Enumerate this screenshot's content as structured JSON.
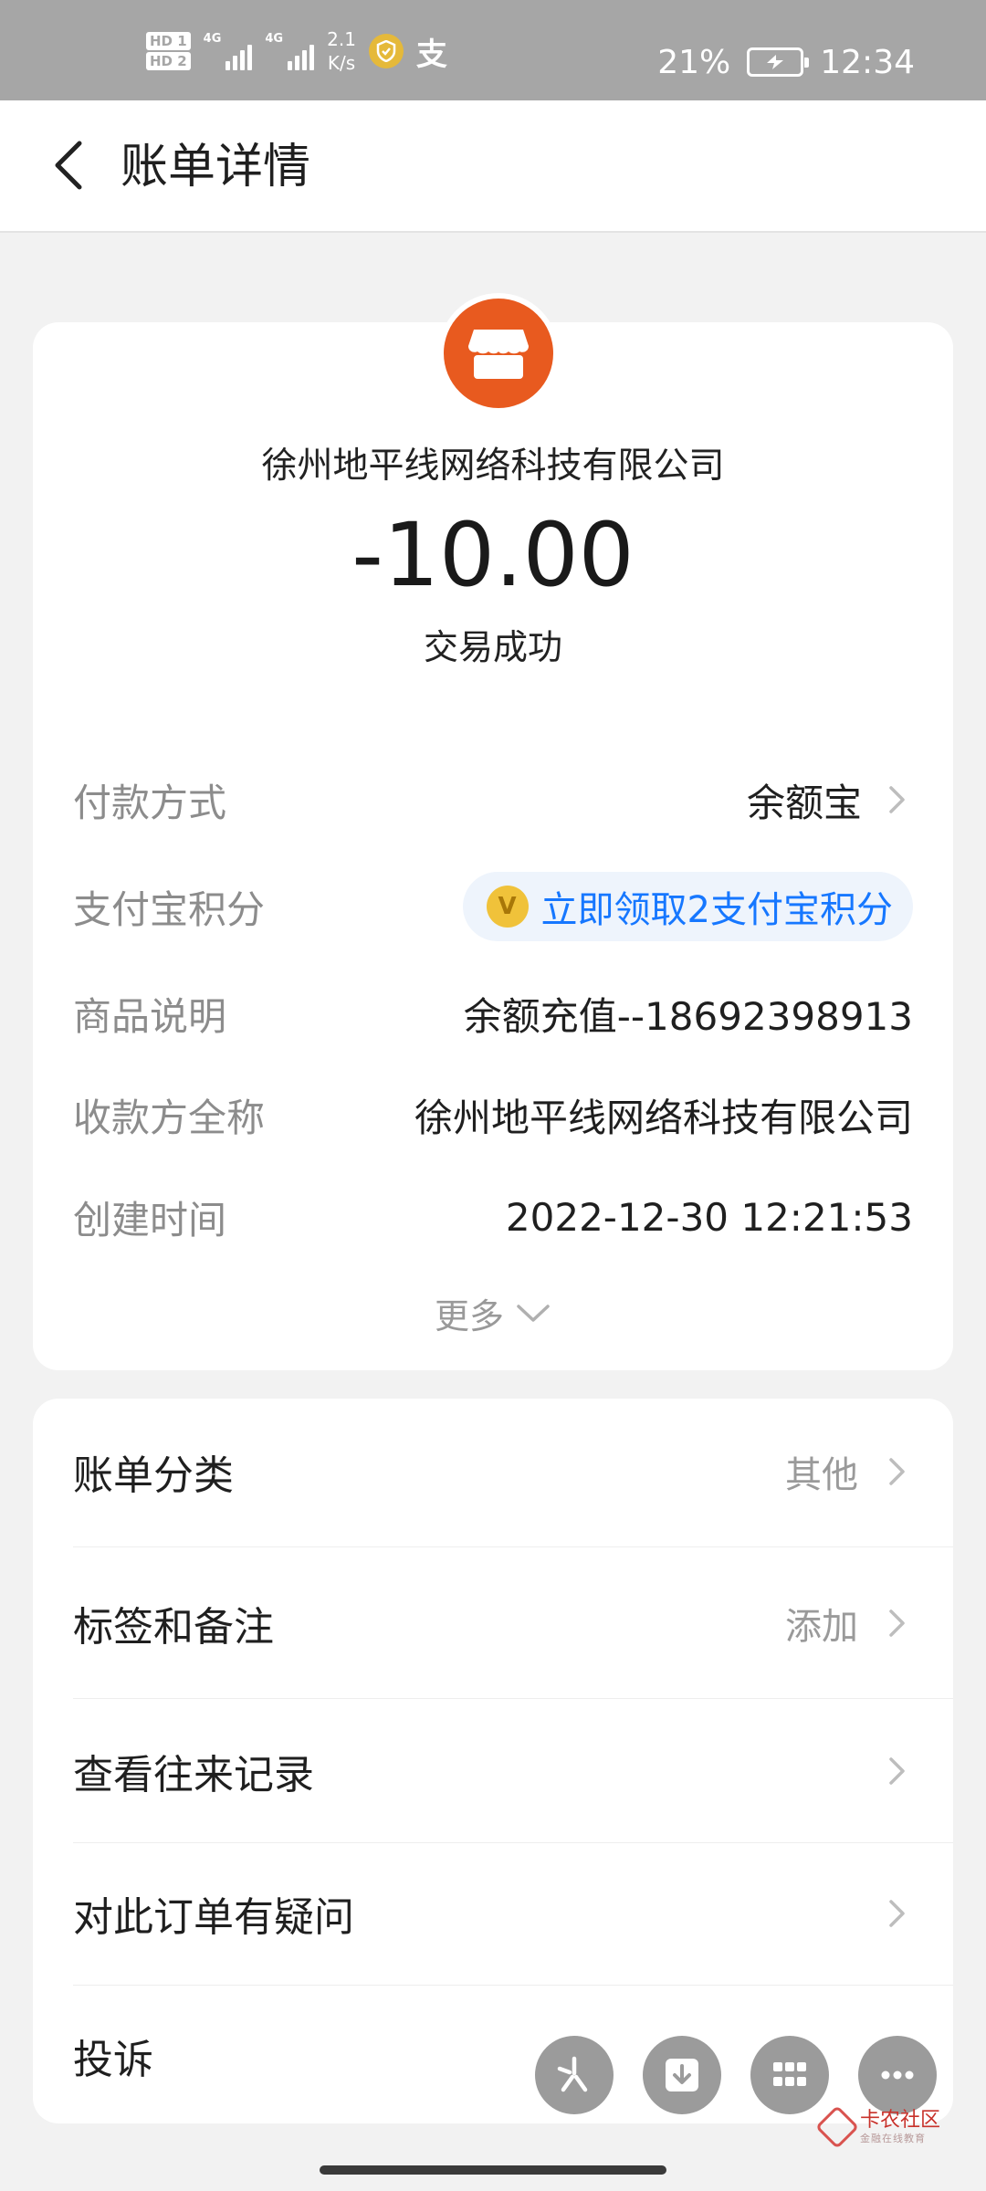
{
  "status_bar": {
    "hd1": "HD 1",
    "hd2": "HD 2",
    "sim1_net": "4G",
    "sim2_net": "4G",
    "speed_value": "2.1",
    "speed_unit": "K/s",
    "battery_percent": "21%",
    "battery_level": 0.21,
    "time": "12:34",
    "alipay_glyph": "支"
  },
  "nav": {
    "title": "账单详情"
  },
  "summary": {
    "merchant_name": "徐州地平线网络科技有限公司",
    "amount": "-10.00",
    "status": "交易成功"
  },
  "details": {
    "payment_method": {
      "label": "付款方式",
      "value": "余额宝"
    },
    "points": {
      "label": "支付宝积分",
      "value": "立即领取2支付宝积分",
      "coin_glyph": "V"
    },
    "product_desc": {
      "label": "商品说明",
      "value": "余额充值--18692398913"
    },
    "payee_fullname": {
      "label": "收款方全称",
      "value": "徐州地平线网络科技有限公司"
    },
    "created_time": {
      "label": "创建时间",
      "value": "2022-12-30 12:21:53"
    },
    "more_label": "更多"
  },
  "actions": {
    "category": {
      "label": "账单分类",
      "value": "其他"
    },
    "tags_notes": {
      "label": "标签和备注",
      "value": "添加"
    },
    "history": {
      "label": "查看往来记录"
    },
    "question": {
      "label": "对此订单有疑问"
    },
    "complaint": {
      "label": "投诉"
    }
  },
  "floating_buttons": [
    "sparkle-icon",
    "download-icon",
    "grid-icon",
    "more-icon"
  ],
  "watermark": {
    "name": "卡农社区",
    "sub": "金融在线教育"
  },
  "colors": {
    "status_bar_bg": "#a6a6a6",
    "merchant_logo": "#e85a1f",
    "link_blue": "#1677ff",
    "fab_gray": "#9b9b9b"
  }
}
